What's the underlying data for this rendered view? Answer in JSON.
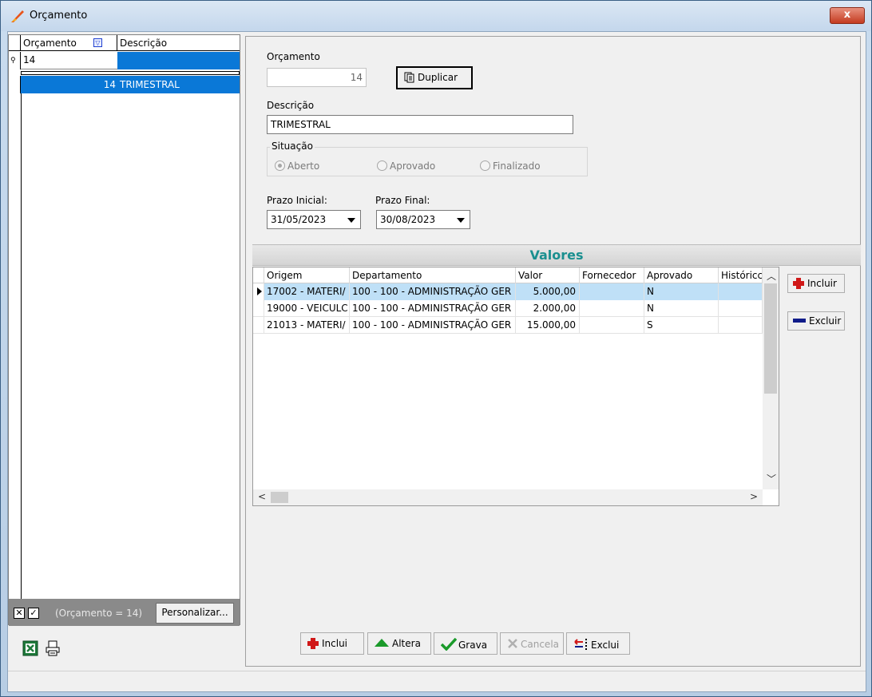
{
  "window": {
    "title": "Orçamento",
    "close_label": "x"
  },
  "left_grid": {
    "columns": [
      "Orçamento",
      "Descrição"
    ],
    "filter_value": "14",
    "rows": [
      {
        "orcamento": "14",
        "descricao": "TRIMESTRAL"
      }
    ],
    "filter_text": "(Orçamento = 14)",
    "customize_label": "Personalizar...",
    "check_x": "✕",
    "check_v": "✓"
  },
  "form": {
    "orcamento_label": "Orçamento",
    "orcamento_value": "14",
    "duplicar_label": "Duplicar",
    "descricao_label": "Descrição",
    "descricao_value": "TRIMESTRAL",
    "situacao_label": "Situação",
    "situacao_options": [
      "Aberto",
      "Aprovado",
      "Finalizado"
    ],
    "situacao_selected": "Aberto",
    "prazo_inicial_label": "Prazo Inicial:",
    "prazo_inicial_value": "31/05/2023",
    "prazo_final_label": "Prazo Final:",
    "prazo_final_value": "30/08/2023"
  },
  "valores": {
    "title": "Valores",
    "columns": [
      "Origem",
      "Departamento",
      "Valor",
      "Fornecedor",
      "Aprovado",
      "Históricc"
    ],
    "rows": [
      {
        "origem": "17002 - MATERI/",
        "departamento": "100 - 100 - ADMINISTRAÇÃO GER",
        "valor": "5.000,00",
        "fornecedor": "",
        "aprovado": "N",
        "historico": ""
      },
      {
        "origem": "19000 - VEICULC",
        "departamento": "100 - 100 - ADMINISTRAÇÃO GER",
        "valor": "2.000,00",
        "fornecedor": "",
        "aprovado": "N",
        "historico": ""
      },
      {
        "origem": "21013 - MATERI/",
        "departamento": "100 - 100 - ADMINISTRAÇÃO GER",
        "valor": "15.000,00",
        "fornecedor": "",
        "aprovado": "S",
        "historico": ""
      }
    ],
    "incluir_label": "Incluir",
    "excluir_label": "Excluir"
  },
  "actions": {
    "inclui": "Inclui",
    "altera": "Altera",
    "grava": "Grava",
    "cancela": "Cancela",
    "exclui": "Exclui"
  },
  "colors": {
    "selection": "#0a78d7",
    "valores_title": "#1a8f8f",
    "accent_red": "#d01818",
    "accent_green": "#1a9a2a"
  }
}
